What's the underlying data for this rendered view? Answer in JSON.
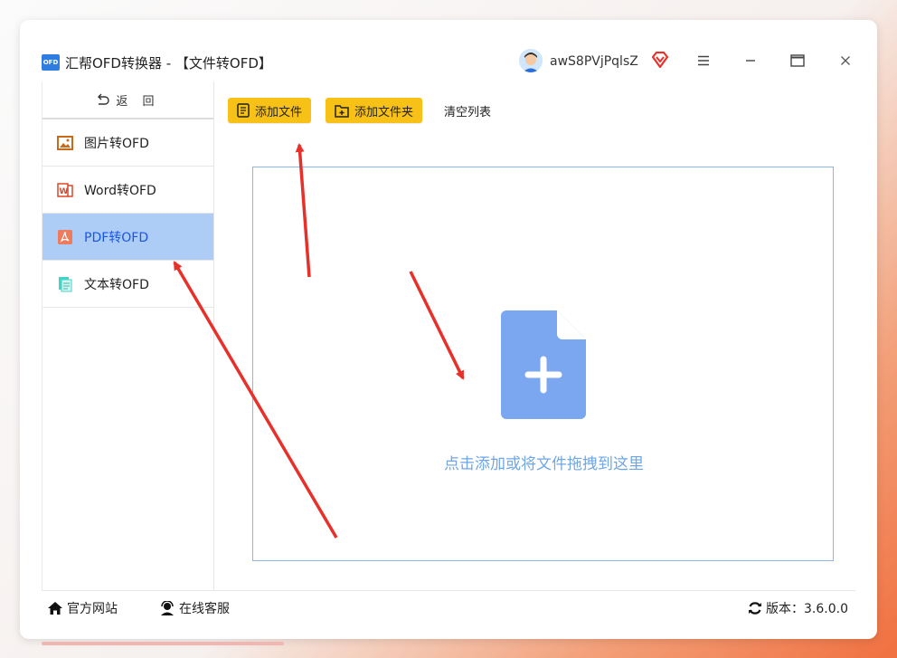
{
  "window": {
    "logo_text": "OFD",
    "title": "汇帮OFD转换器 - 【文件转OFD】",
    "username": "awS8PVjPqlsZ",
    "controls": [
      "menu-icon",
      "minimize-icon",
      "maximize-icon",
      "close-icon"
    ]
  },
  "sidebar": {
    "back_label": "返 回",
    "items": [
      {
        "label": "图片转OFD",
        "icon": "image-icon",
        "active": false
      },
      {
        "label": "Word转OFD",
        "icon": "word-icon",
        "active": false
      },
      {
        "label": "PDF转OFD",
        "icon": "pdf-icon",
        "active": true
      },
      {
        "label": "文本转OFD",
        "icon": "text-file-icon",
        "active": false
      }
    ]
  },
  "toolbar": {
    "add_file": "添加文件",
    "add_folder": "添加文件夹",
    "clear_list": "清空列表"
  },
  "dropzone": {
    "hint": "点击添加或将文件拖拽到这里"
  },
  "footer": {
    "website": "官方网站",
    "support": "在线客服",
    "version": "版本：3.6.0.0"
  },
  "colors": {
    "accent_yellow": "#f7c117",
    "active_bg": "#aecdf6",
    "active_text": "#1a55e6",
    "dropzone_border": "#8ab7e8",
    "hint_text": "#6fa6e4",
    "annotation_arrow": "#e8302a"
  }
}
